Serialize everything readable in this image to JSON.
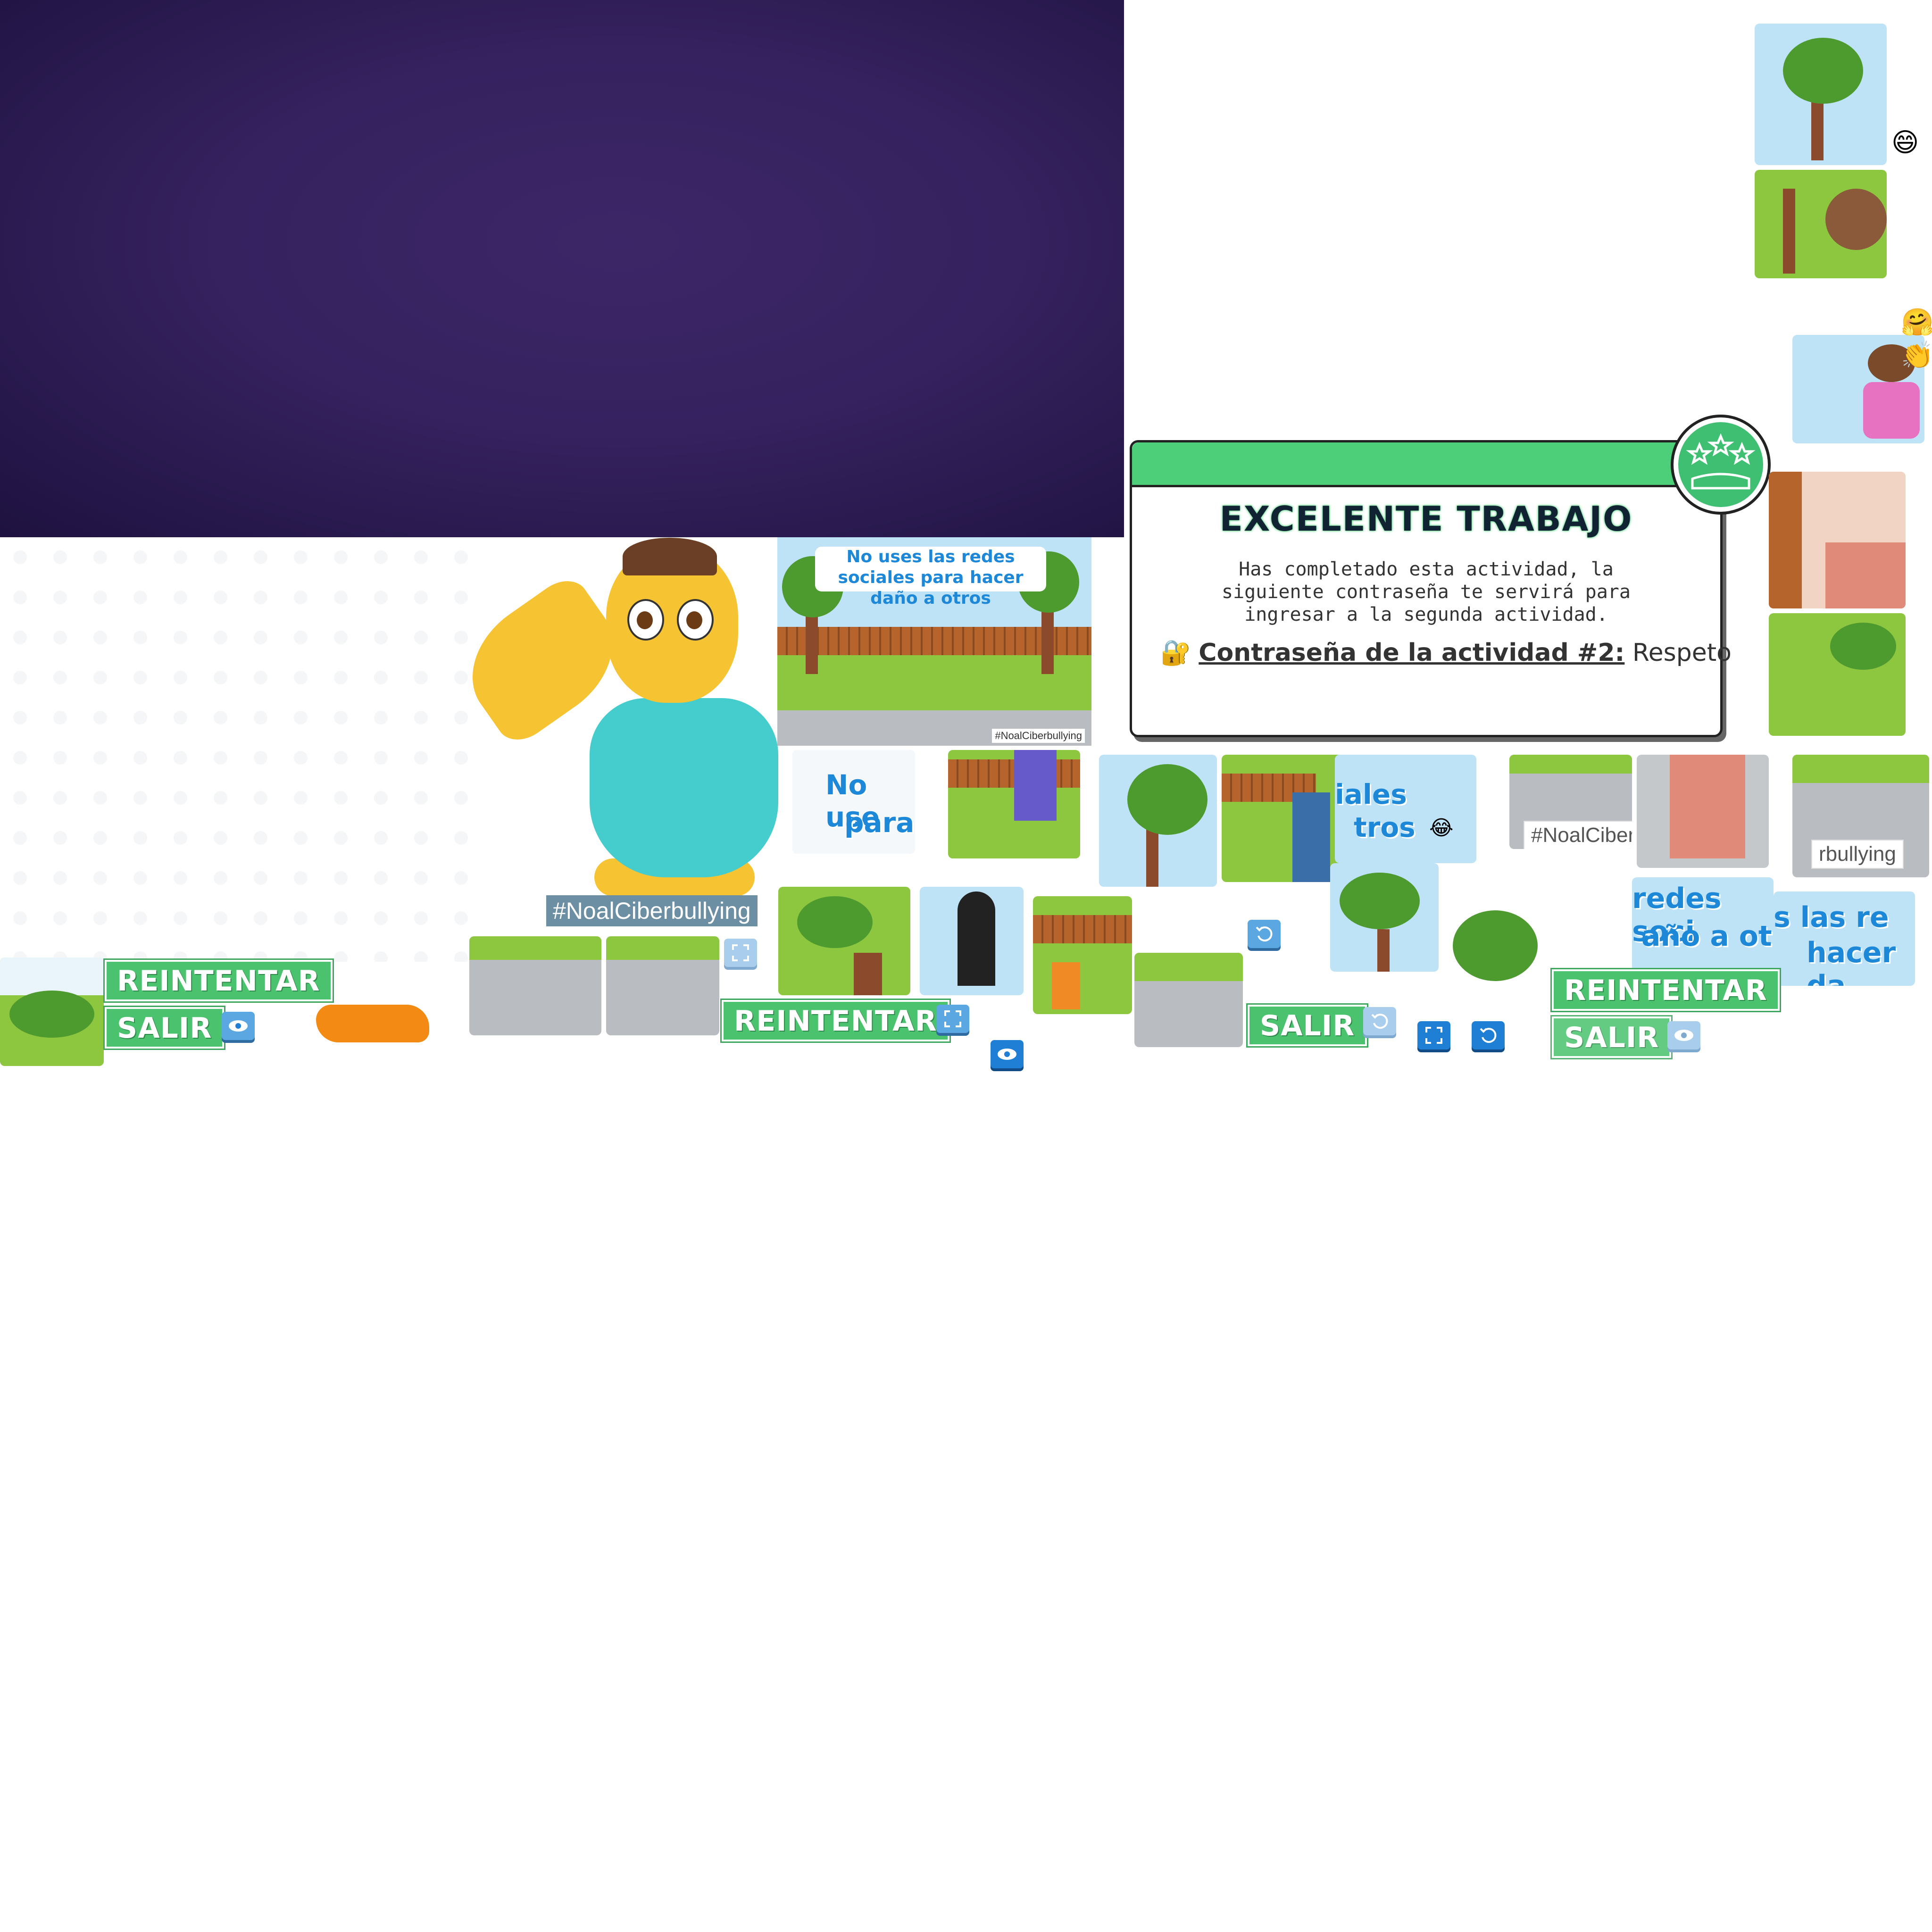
{
  "modal": {
    "title": "EXCELENTE TRABAJO",
    "message": "Has completado esta actividad, la siguiente contraseña te servirá para ingresar a la segunda actividad.",
    "password_label": "Contraseña de la actividad #2:",
    "password_value": "Respeto",
    "lock_icon": "🔐"
  },
  "scene": {
    "title": "No uses las redes sociales para hacer daño a otros",
    "hashtag": "#NoalCiberbullying"
  },
  "hashtags": {
    "main": "#NoalCiberbullying",
    "piece_left": "#NoalCiber",
    "piece_right": "rbullying"
  },
  "puzzle_fragments": {
    "frag_a": "No use",
    "frag_b": "para",
    "frag_c": "iales",
    "frag_d": "tros",
    "frag_e": "redes soci",
    "frag_f": "año a ot",
    "frag_g": "s las re",
    "frag_h": "hacer da"
  },
  "buttons": {
    "retry": "REINTENTAR",
    "exit": "SALIR"
  },
  "emojis": {
    "grin": "😄",
    "hug": "🤗",
    "clap": "👏",
    "joy": "😂"
  },
  "colors": {
    "banner": "#36225f",
    "accent_green": "#4ac26e",
    "button_blue": "#1f7fd4",
    "bird_yellow": "#f6c433",
    "shirt_teal": "#45cccd"
  }
}
